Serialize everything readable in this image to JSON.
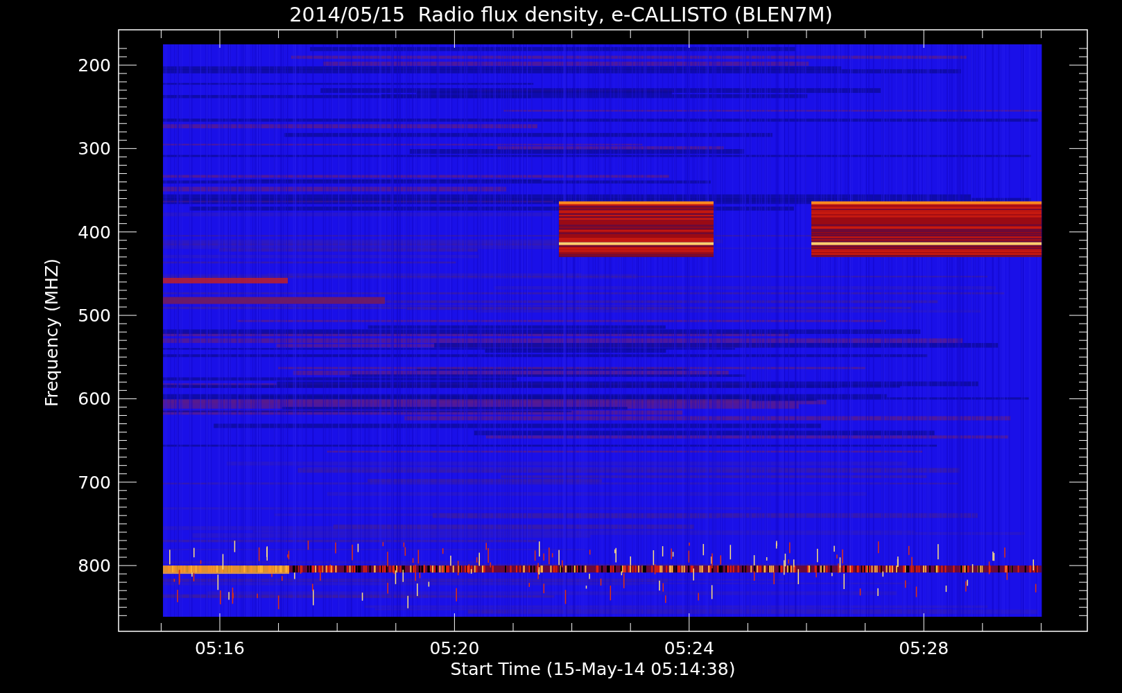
{
  "title": "2014/05/15  Radio flux density, e-CALLISTO (BLEN7M)",
  "y_axis": {
    "label": "Frequency (MHZ)",
    "ticks": [
      "200",
      "300",
      "400",
      "500",
      "600",
      "700",
      "800"
    ]
  },
  "x_axis": {
    "label": "Start Time (15-May-14 05:14:38)",
    "ticks": [
      "05:16",
      "05:20",
      "05:24",
      "05:28"
    ]
  }
}
